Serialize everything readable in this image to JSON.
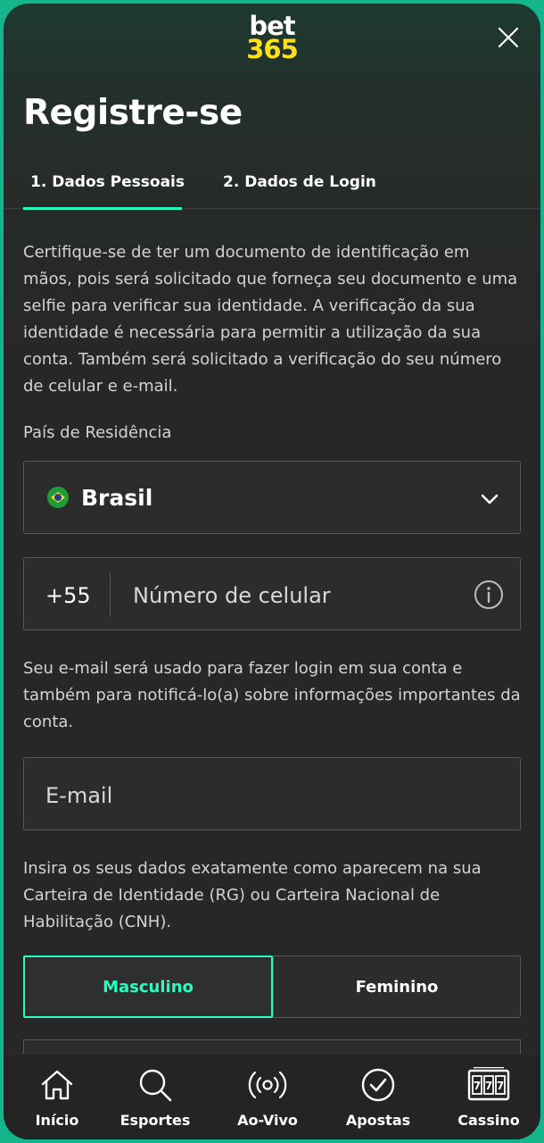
{
  "logo": {
    "line1": "bet",
    "line2": "365"
  },
  "title": "Registre-se",
  "tabs": [
    {
      "label": "1.  Dados Pessoais",
      "active": true
    },
    {
      "label": "2.  Dados de Login",
      "active": false
    }
  ],
  "intro_text": "Certifique-se de ter um documento de identificação em mãos, pois será solicitado que forneça seu documento e uma selfie para verificar sua identidade. A verificação da sua identidade é necessária para permitir a utilização da sua conta. Também será solicitado a verificação do seu número de celular e e-mail.",
  "country": {
    "label": "País de Residência",
    "value": "Brasil"
  },
  "phone": {
    "prefix": "+55",
    "placeholder": "Número de celular"
  },
  "email_text": "Seu e-mail será usado para fazer login em sua conta e também para notificá-lo(a) sobre informações importantes da conta.",
  "email": {
    "placeholder": "E-mail"
  },
  "id_text": "Insira os seus dados exatamente como aparecem na sua Carteira de Identidade (RG) ou Carteira Nacional de Habilitação (CNH).",
  "gender": {
    "male": "Masculino",
    "female": "Feminino",
    "selected": "Masculino"
  },
  "nav": [
    {
      "label": "Início",
      "icon": "home-icon"
    },
    {
      "label": "Esportes",
      "icon": "search-icon"
    },
    {
      "label": "Ao-Vivo",
      "icon": "live-icon"
    },
    {
      "label": "Apostas",
      "icon": "check-circle-icon"
    },
    {
      "label": "Cassino",
      "icon": "slot-machine-icon"
    }
  ],
  "colors": {
    "accent": "#26ffbe",
    "logo_yellow": "#ffdf1b",
    "background": "#272727",
    "frame": "#14b58a"
  }
}
